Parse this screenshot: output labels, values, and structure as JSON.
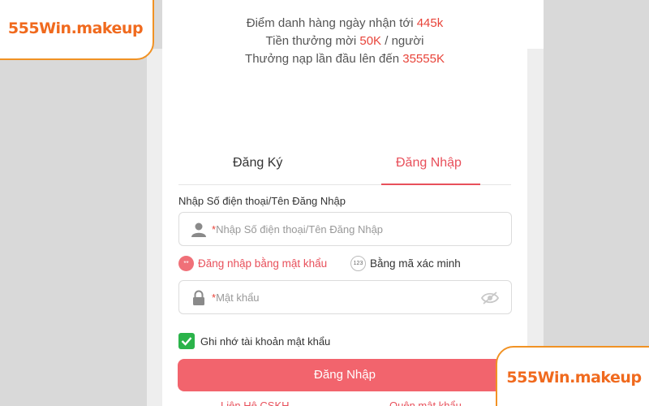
{
  "promo": {
    "line1_prefix": "Điểm danh hàng ngày nhận tới ",
    "line1_value": "445k",
    "line2_prefix": "Tiền thưởng mời ",
    "line2_value": "50K",
    "line2_suffix": " / người",
    "line3_prefix": "Thưởng nạp lần đầu lên đến ",
    "line3_value": "35555K"
  },
  "tabs": {
    "register": "Đăng Ký",
    "login": "Đăng Nhập",
    "active": "login"
  },
  "form": {
    "username_label": "Nhập Số điện thoại/Tên Đăng Nhập",
    "required_mark": "*",
    "username_placeholder": "Nhập Số điện thoại/Tên Đăng Nhập",
    "password_placeholder": "Mật khẩu",
    "method_password": "Đăng nhập bằng mật khẩu",
    "method_password_icon_text": "**",
    "method_code": "Bằng mã xác minh",
    "method_code_icon_text": "123",
    "remember_label": "Ghi nhớ tài khoản mật khẩu",
    "remember_checked": true,
    "submit_label": "Đăng Nhập",
    "link_left": "Liên Hệ CSKH",
    "link_right": "Quên mật khẩu"
  },
  "watermark": {
    "text": "555Win.makeup"
  },
  "colors": {
    "accent": "#e8505b",
    "highlight": "#e8443a",
    "button": "#f2646d",
    "checkbox": "#2bb34a",
    "badge_border": "#f19224",
    "badge_text": "#f06a1e"
  },
  "icons": {
    "username": "user-icon",
    "password": "lock-icon",
    "visibility": "eye-slash-icon"
  }
}
